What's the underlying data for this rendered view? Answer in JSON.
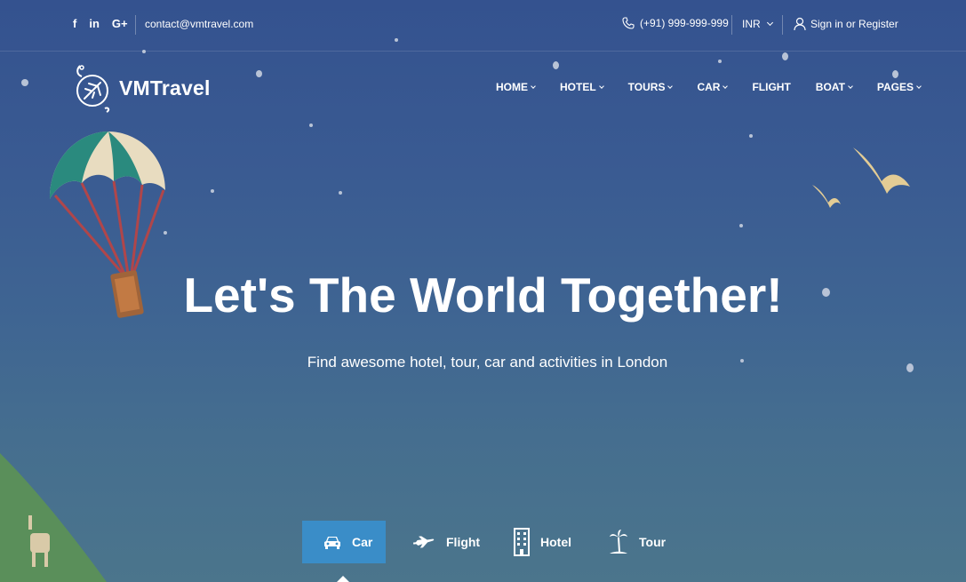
{
  "topbar": {
    "social": [
      "f",
      "in",
      "G+"
    ],
    "email": "contact@vmtravel.com",
    "phone": "(+91) 999-999-999",
    "currency": "INR",
    "signin": "Sign in or Register"
  },
  "brand": {
    "name": "VMTravel"
  },
  "nav": [
    {
      "label": "HOME"
    },
    {
      "label": "HOTEL"
    },
    {
      "label": "TOURS"
    },
    {
      "label": "CAR"
    },
    {
      "label": "FLIGHT"
    },
    {
      "label": "BOAT"
    },
    {
      "label": "PAGES"
    }
  ],
  "hero": {
    "title": "Let's The World Together!",
    "subtitle": "Find awesome hotel, tour, car and activities in London"
  },
  "search_tabs": [
    {
      "label": "Car",
      "icon": "car-icon",
      "active": true
    },
    {
      "label": "Flight",
      "icon": "plane-icon",
      "active": false
    },
    {
      "label": "Hotel",
      "icon": "building-icon",
      "active": false
    },
    {
      "label": "Tour",
      "icon": "palm-tree-icon",
      "active": false
    }
  ],
  "colors": {
    "accent": "#3a8dc8",
    "bg_top": "#34528f",
    "bg_bottom": "#4b758c"
  }
}
